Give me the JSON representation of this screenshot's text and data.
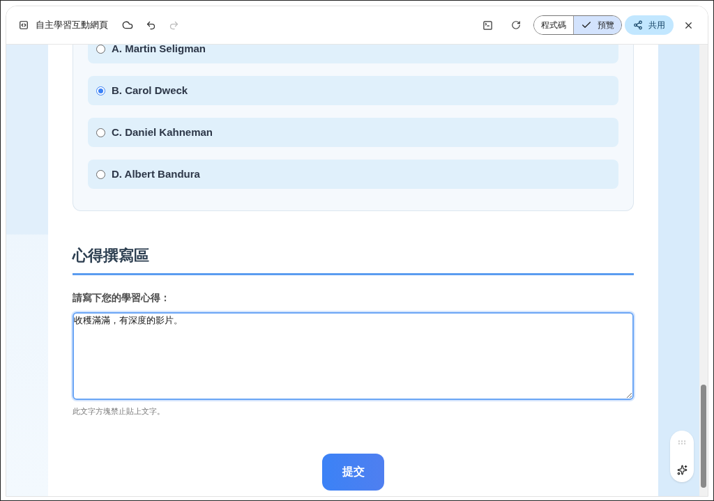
{
  "header": {
    "title": "自主學習互動網頁",
    "redo_disabled": true,
    "view_toggle": [
      {
        "label": "程式碼",
        "selected": false
      },
      {
        "label": "預覽",
        "selected": true
      }
    ],
    "share_button": "共用"
  },
  "quiz": {
    "options": [
      {
        "label": "A. Martin Seligman",
        "selected": false
      },
      {
        "label": "B. Carol Dweck",
        "selected": true
      },
      {
        "label": "C. Daniel Kahneman",
        "selected": false
      },
      {
        "label": "D. Albert Bandura",
        "selected": false
      }
    ]
  },
  "reflection": {
    "heading": "心得撰寫區",
    "label": "請寫下您的學習心得：",
    "value": "收穫滿滿，有深度的影片。",
    "hint": "此文字方塊禁止貼上文字。"
  },
  "submit_button": "提交"
}
